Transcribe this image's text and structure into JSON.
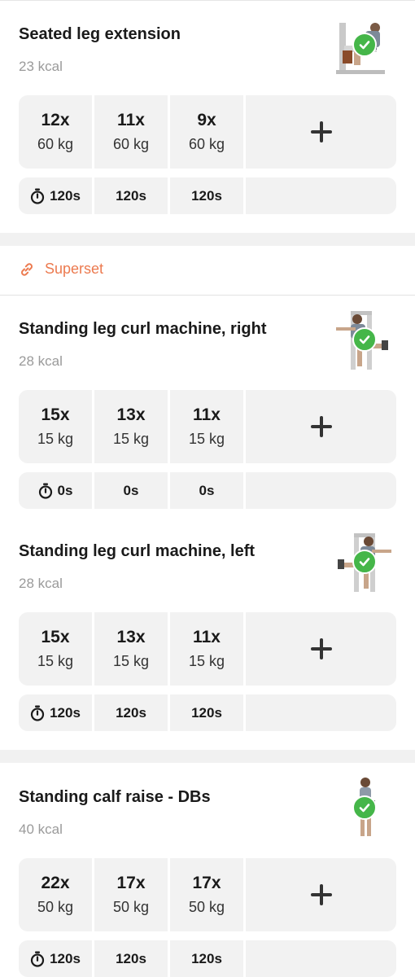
{
  "accent_color": "#ec7a4f",
  "check_color": "#45b649",
  "superset": {
    "label": "Superset",
    "icon": "link-icon"
  },
  "exercises": [
    {
      "title": "Seated leg extension",
      "kcal": "23 kcal",
      "done": true,
      "sets": [
        {
          "reps": "12x",
          "weight": "60 kg"
        },
        {
          "reps": "11x",
          "weight": "60 kg"
        },
        {
          "reps": "9x",
          "weight": "60 kg"
        }
      ],
      "rests": [
        "120s",
        "120s",
        "120s"
      ]
    },
    {
      "title": "Standing leg curl machine, right",
      "kcal": "28 kcal",
      "done": true,
      "sets": [
        {
          "reps": "15x",
          "weight": "15 kg"
        },
        {
          "reps": "13x",
          "weight": "15 kg"
        },
        {
          "reps": "11x",
          "weight": "15 kg"
        }
      ],
      "rests": [
        "0s",
        "0s",
        "0s"
      ]
    },
    {
      "title": "Standing leg curl machine, left",
      "kcal": "28 kcal",
      "done": true,
      "sets": [
        {
          "reps": "15x",
          "weight": "15 kg"
        },
        {
          "reps": "13x",
          "weight": "15 kg"
        },
        {
          "reps": "11x",
          "weight": "15 kg"
        }
      ],
      "rests": [
        "120s",
        "120s",
        "120s"
      ]
    },
    {
      "title": "Standing calf raise - DBs",
      "kcal": "40 kcal",
      "done": true,
      "sets": [
        {
          "reps": "22x",
          "weight": "50 kg"
        },
        {
          "reps": "17x",
          "weight": "50 kg"
        },
        {
          "reps": "17x",
          "weight": "50 kg"
        }
      ],
      "rests": [
        "120s",
        "120s",
        "120s"
      ]
    }
  ]
}
